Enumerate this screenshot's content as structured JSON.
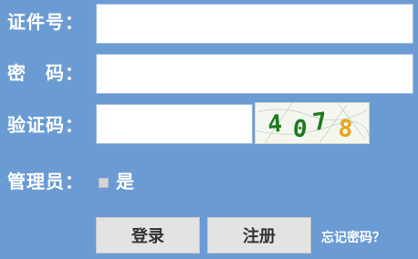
{
  "form": {
    "id_label": "证件号：",
    "password_label": "密　码：",
    "captcha_label": "验证码：",
    "admin_label": "管理员：",
    "admin_option": "是",
    "id_value": "",
    "password_value": "",
    "captcha_value": ""
  },
  "captcha": {
    "chars": [
      "4",
      "0",
      "7",
      "8"
    ],
    "colors": [
      "#1c7a1c",
      "#1c7a1c",
      "#1c7a1c",
      "#e8a31c"
    ]
  },
  "buttons": {
    "login": "登录",
    "register": "注册",
    "forgot": "忘记密码？"
  }
}
